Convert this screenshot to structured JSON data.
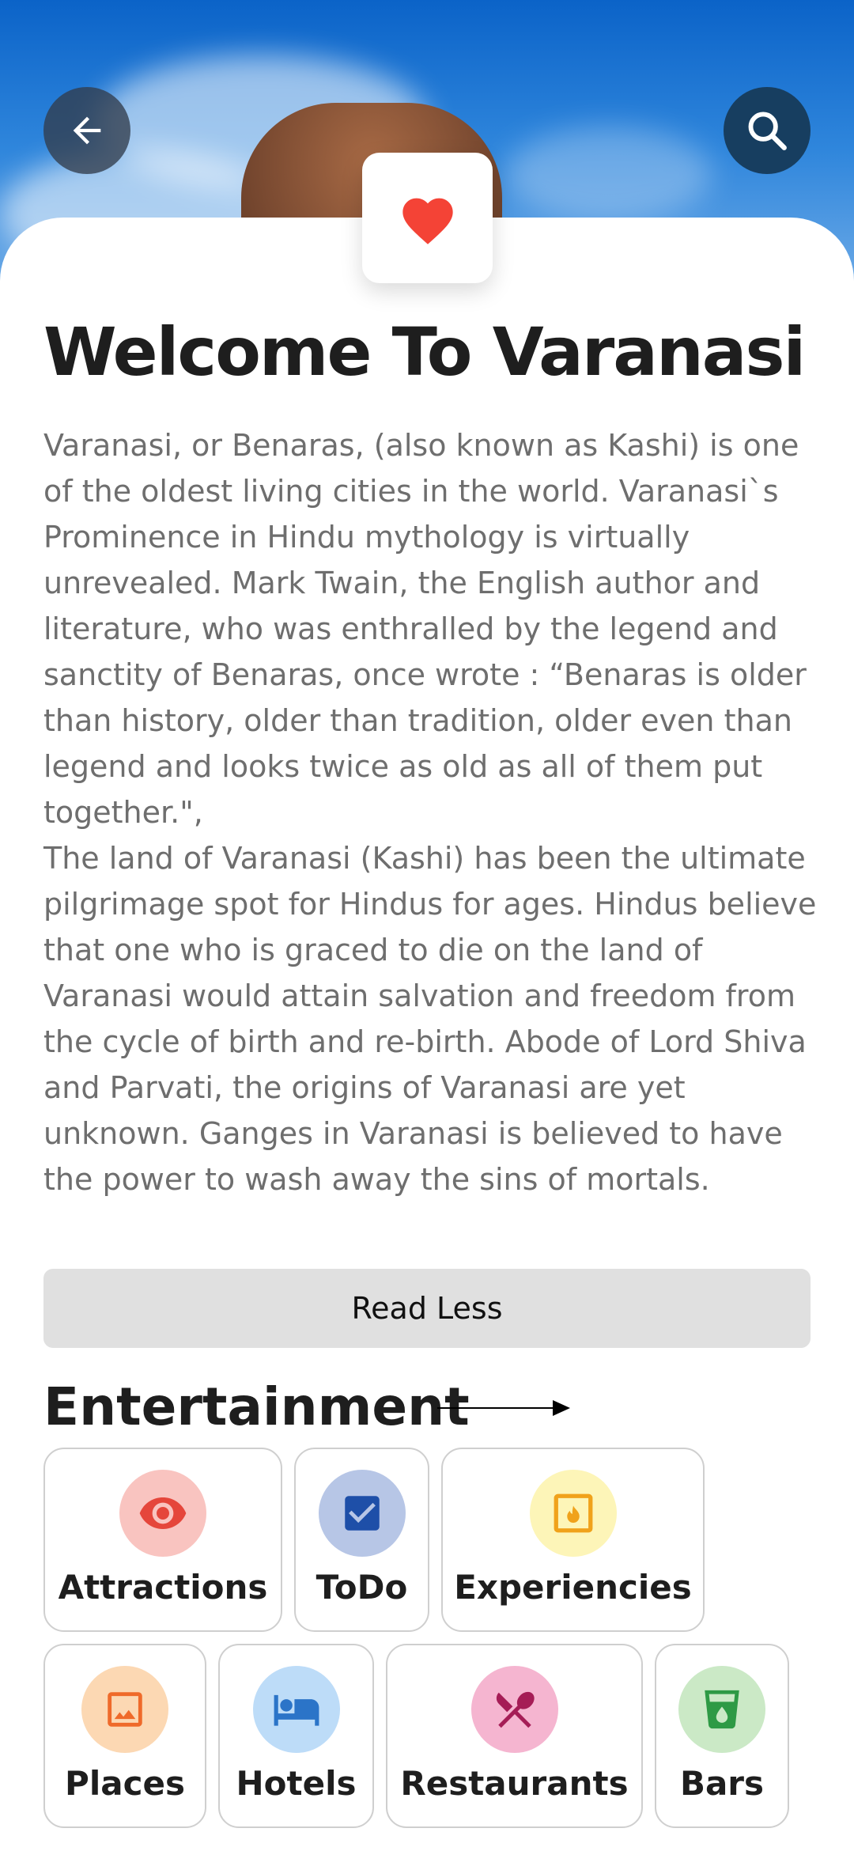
{
  "page": {
    "title": "Welcome To Varanasi",
    "description": "Varanasi, or Benaras, (also known as Kashi) is one of the oldest living cities in the world. Varanasi`s Prominence in Hindu mythology is virtually unrevealed. Mark Twain, the English author and literature, who was enthralled by the legend and sanctity of Benaras, once wrote : “Benaras is older than history, older than tradition, older even than legend and looks twice as old as all of them put together.\",\n The land of Varanasi (Kashi) has been the ultimate pilgrimage spot for Hindus for ages. Hindus believe that one who is graced to die on the land of Varanasi would attain salvation and freedom from the cycle of birth and re-birth. Abode of Lord Shiva and Parvati, the origins of Varanasi are yet unknown. Ganges in Varanasi is believed to have the power to wash away the sins of mortals.",
    "read_less_label": "Read Less"
  },
  "section": {
    "title": "Entertainment"
  },
  "categories": [
    {
      "label": "Attractions",
      "icon": "eye-icon",
      "icon_color": "#e5463b",
      "bg_color": "#f9c4c0"
    },
    {
      "label": "ToDo",
      "icon": "checkbox-icon",
      "icon_color": "#1e4fa8",
      "bg_color": "#b7c6e6"
    },
    {
      "label": "Experiencies",
      "icon": "fireplace-icon",
      "icon_color": "#f0a21b",
      "bg_color": "#fdf5b8"
    },
    {
      "label": "Places",
      "icon": "image-icon",
      "icon_color": "#ef6a2a",
      "bg_color": "#fcd8b3"
    },
    {
      "label": "Hotels",
      "icon": "bed-icon",
      "icon_color": "#2b74c8",
      "bg_color": "#bddcf8"
    },
    {
      "label": "Restaurants",
      "icon": "restaurant-icon",
      "icon_color": "#a51d56",
      "bg_color": "#f5b5d0"
    },
    {
      "label": "Bars",
      "icon": "drink-icon",
      "icon_color": "#2e9a45",
      "bg_color": "#cbe9c6"
    }
  ],
  "colors": {
    "heart": "#f44336",
    "title": "#1e1e1e",
    "body_text": "#6e6e6e"
  }
}
